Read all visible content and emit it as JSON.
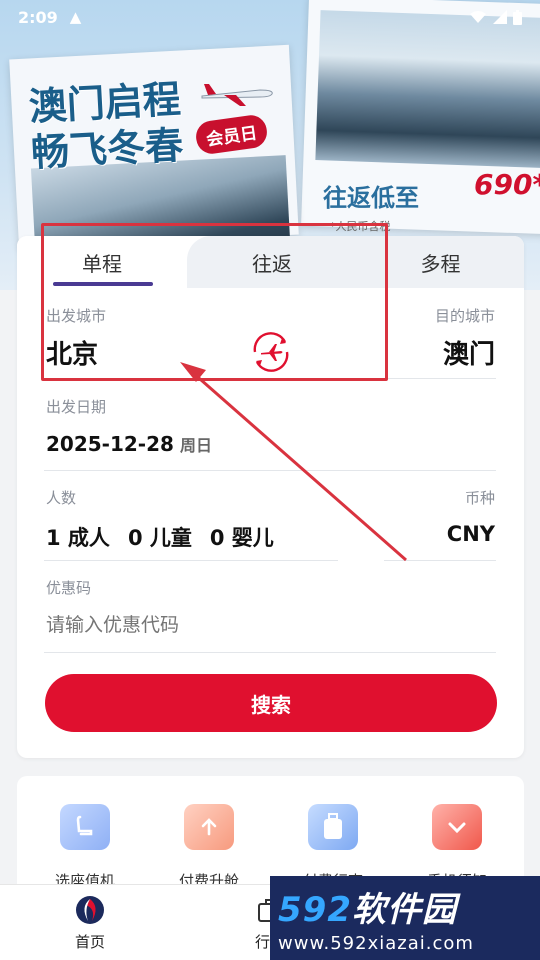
{
  "status_bar": {
    "time": "2:09",
    "warning": "▲"
  },
  "banner": {
    "title_line1": "澳门启程",
    "title_line2": "畅飞冬春",
    "badge": "会员日",
    "subtitle": "往返低至",
    "price": "690*",
    "note": "*人民币含税"
  },
  "tabs": [
    {
      "label": "单程"
    },
    {
      "label": "往返"
    },
    {
      "label": "多程"
    }
  ],
  "route": {
    "origin_label": "出发城市",
    "origin": "北京",
    "dest_label": "目的城市",
    "dest": "澳门"
  },
  "date": {
    "label": "出发日期",
    "value": "2025-12-28",
    "weekday": "周日"
  },
  "passengers": {
    "label": "人数",
    "adult": "1 成人",
    "child": "0 儿童",
    "infant": "0 婴儿"
  },
  "currency": {
    "label": "币种",
    "value": "CNY"
  },
  "promo": {
    "label": "优惠码",
    "placeholder": "请输入优惠代码"
  },
  "search_label": "搜索",
  "services": [
    {
      "label": "选座值机",
      "icon": "seat-icon"
    },
    {
      "label": "付费升舱",
      "icon": "upgrade-icon"
    },
    {
      "label": "付费行李",
      "icon": "luggage-icon"
    },
    {
      "label": "乘机须知",
      "icon": "notice-icon"
    }
  ],
  "nav": {
    "home": "首页",
    "trip": "行程"
  },
  "watermark": {
    "brand_num": "592",
    "brand_text": "软件园",
    "url": "www.592xiazai.com"
  },
  "colors": {
    "brand_red": "#e0102f",
    "tab_accent": "#4a3a93",
    "annotation": "#d9333f"
  }
}
